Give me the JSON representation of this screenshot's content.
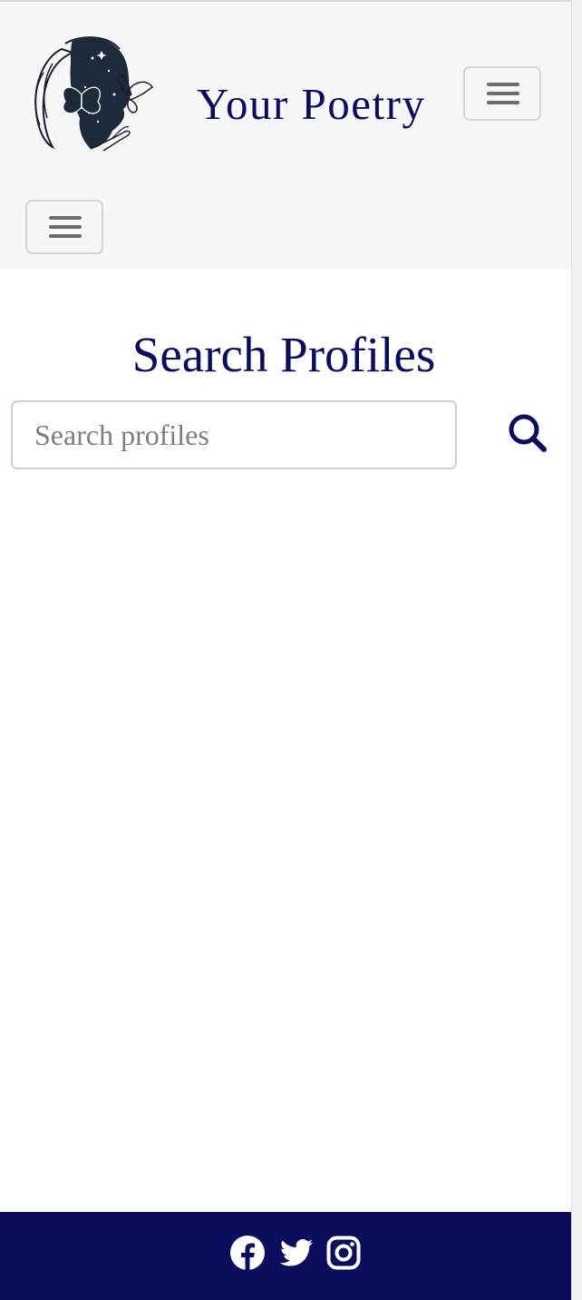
{
  "header": {
    "brand_title": "Your Poetry",
    "logo_icon": "poet-face-butterflies-logo",
    "menu_toggle_icon": "hamburger-menu-icon"
  },
  "main": {
    "heading": "Search Profiles",
    "search": {
      "placeholder": "Search profiles",
      "value": "",
      "button_icon": "search-icon"
    }
  },
  "footer": {
    "social_links": [
      "facebook-icon",
      "twitter-icon",
      "instagram-icon"
    ]
  },
  "colors": {
    "brand_navy": "#0b0d5c",
    "navbar_bg": "#f7f7f7",
    "page_bg": "#ffffff",
    "toggler_border": "#d6d6d6"
  }
}
